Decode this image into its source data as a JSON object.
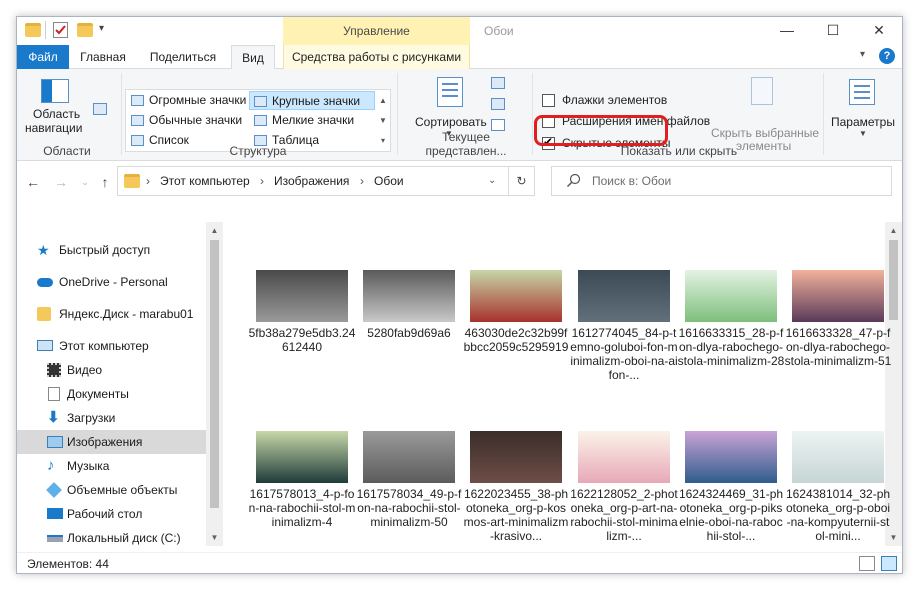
{
  "window": {
    "title": "Обои",
    "context_tab_header": "Управление",
    "minimize_glyph": "—",
    "maximize_glyph": "☐",
    "close_glyph": "✕"
  },
  "tabs": {
    "file": "Файл",
    "home": "Главная",
    "share": "Поделиться",
    "view": "Вид",
    "picture_tools": "Средства работы с рисунками"
  },
  "ribbon": {
    "panes": {
      "nav_pane_line1": "Область",
      "nav_pane_line2": "навигации",
      "group_label": "Области"
    },
    "layout": {
      "items": [
        "Огромные значки",
        "Крупные значки",
        "Обычные значки",
        "Мелкие значки",
        "Список",
        "Таблица"
      ],
      "selected": "Крупные значки",
      "group_label": "Структура"
    },
    "current_view": {
      "sort_label": "Сортировать",
      "group_label": "Текущее представлен..."
    },
    "show_hide": {
      "item_checkboxes": "Флажки элементов",
      "item_checkboxes_checked": false,
      "file_extensions": "Расширения имен файлов",
      "file_extensions_checked": false,
      "hidden_items": "Скрытые элементы",
      "hidden_items_checked": true,
      "hide_selected_line1": "Скрыть выбранные",
      "hide_selected_line2": "элементы",
      "group_label": "Показать или скрыть"
    },
    "options_label": "Параметры"
  },
  "address": {
    "crumbs": [
      "Этот компьютер",
      "Изображения",
      "Обои"
    ],
    "separator": "›",
    "search_placeholder": "Поиск в: Обои"
  },
  "nav_pane": {
    "items": [
      {
        "label": "Быстрый доступ",
        "icon": "star-icon"
      },
      {
        "label": "OneDrive - Personal",
        "icon": "cloud-icon"
      },
      {
        "label": "Яндекс.Диск - marabu01",
        "icon": "yandex-disk-icon"
      },
      {
        "label": "Этот компьютер",
        "icon": "computer-icon"
      },
      {
        "label": "Видео",
        "icon": "video-icon"
      },
      {
        "label": "Документы",
        "icon": "documents-icon"
      },
      {
        "label": "Загрузки",
        "icon": "downloads-icon"
      },
      {
        "label": "Изображения",
        "icon": "pictures-icon"
      },
      {
        "label": "Музыка",
        "icon": "music-icon"
      },
      {
        "label": "Объемные объекты",
        "icon": "3d-objects-icon"
      },
      {
        "label": "Рабочий стол",
        "icon": "desktop-icon"
      },
      {
        "label": "Локальный диск (C:)",
        "icon": "drive-icon"
      }
    ],
    "selected": "Изображения"
  },
  "files": [
    {
      "name": "5fb38a279e5db3.24612440",
      "color1": "#4a4a4a",
      "color2": "#9a9a9a"
    },
    {
      "name": "5280fab9d69a6",
      "color1": "#5a5a5a",
      "color2": "#c9c9c9"
    },
    {
      "name": "463030de2c32b99fbbcc2059c5295919",
      "color1": "#c6d6a6",
      "color2": "#a8322e"
    },
    {
      "name": "1612774045_84-p-temno-goluboi-fon-minimalizm-oboi-na-aifon-...",
      "color1": "#3c4a55",
      "color2": "#61707b"
    },
    {
      "name": "1616633315_28-p-fon-dlya-rabochego-stola-minimalizm-28",
      "color1": "#e4f3e4",
      "color2": "#7dbf7c"
    },
    {
      "name": "1616633328_47-p-fon-dlya-rabochego-stola-minimalizm-51",
      "color1": "#f2b29b",
      "color2": "#5a3a5a"
    },
    {
      "name": "1617578013_4-p-fon-na-rabochii-stol-minimalizm-4",
      "color1": "#c7d8a8",
      "color2": "#1f3b3a"
    },
    {
      "name": "1617578034_49-p-fon-na-rabochii-stol-minimalizm-50",
      "color1": "#9a9a9a",
      "color2": "#5c5c5c"
    },
    {
      "name": "1622023455_38-photoneka_org-p-kosmos-art-minimalizm-krasivo...",
      "color1": "#3a2d2a",
      "color2": "#6e4e47"
    },
    {
      "name": "1622128052_2-photoneka_org-p-art-na-rabochii-stol-minimalizm-...",
      "color1": "#fbf3e8",
      "color2": "#e7a8b8"
    },
    {
      "name": "1624324469_31-photoneka_org-p-pikselnie-oboi-na-rabochii-stol-...",
      "color1": "#c9a4d6",
      "color2": "#2f5c8c"
    },
    {
      "name": "1624381014_32-photoneka_org-p-oboi-na-kompyuternii-stol-mini...",
      "color1": "#eef3f3",
      "color2": "#c6d5d5"
    }
  ],
  "status": {
    "items_count": "Элементов: 44"
  },
  "colors": {
    "accent": "#1979ca",
    "context_tab": "#fff2b3",
    "highlight_box": "#e02020",
    "selection": "#cce8ff"
  }
}
